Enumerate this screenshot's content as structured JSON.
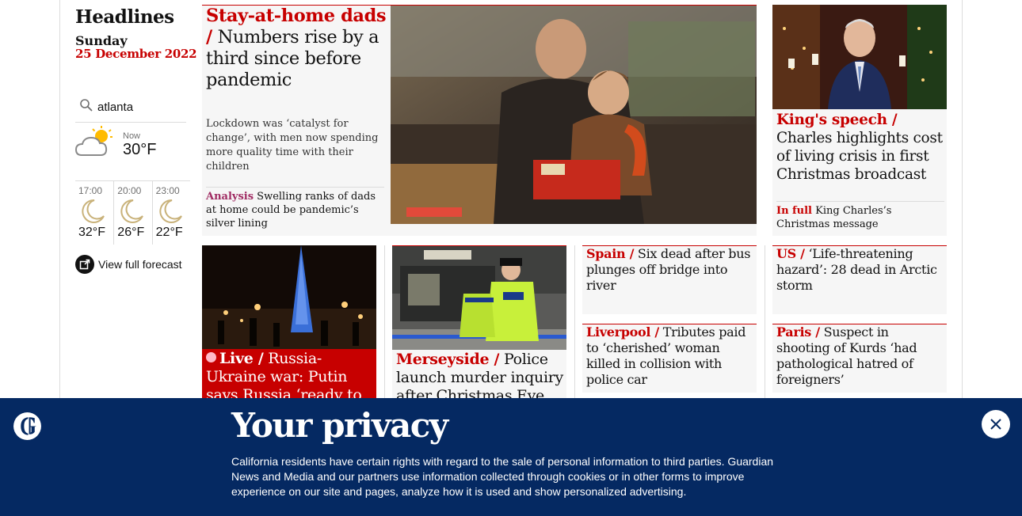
{
  "sidebar": {
    "title": "Headlines",
    "day": "Sunday",
    "date": "25 December 2022",
    "search_value": "atlanta",
    "weather_now_label": "Now",
    "weather_now_temp": "30°F",
    "forecast": [
      {
        "time": "17:00",
        "temp": "32°F",
        "icon": "moon-icon"
      },
      {
        "time": "20:00",
        "temp": "26°F",
        "icon": "moon-icon"
      },
      {
        "time": "23:00",
        "temp": "22°F",
        "icon": "moon-icon"
      }
    ],
    "forecast_link": "View full forecast"
  },
  "lead": {
    "kicker": "Stay-at-home dads",
    "separator": " /",
    "headline": " Numbers rise by a third since before pandemic",
    "standfirst": "Lockdown was ‘catalyst for change’, with men now spending more quality time with their children",
    "sublink_label": "Analysis",
    "sublink_text": " Swelling ranks of dads at home could be pandemic’s silver lining"
  },
  "king": {
    "kicker": "King's speech /",
    "headline": " Charles highlights cost of living crisis in first Christmas broadcast",
    "sublink_label": "In full",
    "sublink_text": " King Charles’s Christmas message"
  },
  "cards": {
    "live": {
      "kicker": "Live /",
      "headline": " Russia-Ukraine war: Putin says Russia ‘ready to"
    },
    "merseyside": {
      "kicker": "Merseyside /",
      "headline": " Police launch murder inquiry after Christmas Eve"
    },
    "spain": {
      "kicker": "Spain /",
      "headline": " Six dead after bus plunges off bridge into river"
    },
    "us": {
      "kicker": "US /",
      "headline": " ‘Life-threatening hazard’: 28 dead in Arctic storm"
    },
    "liverpool": {
      "kicker": "Liverpool /",
      "headline": " Tributes paid to ‘cherished’ woman killed in collision with police car"
    },
    "paris": {
      "kicker": "Paris /",
      "headline": " Suspect in shooting of Kurds ‘had pathological hatred of foreigners’"
    }
  },
  "privacy": {
    "title": "Your privacy",
    "text": "California residents have certain rights with regard to the sale of personal information to third parties. Guardian News and Media and our partners use information collected through cookies or in other forms to improve experience on our site and pages, analyze how it is used and show personalized advertising."
  },
  "colors": {
    "accent_red": "#c70000",
    "analysis_pink": "#a02c63",
    "banner_blue": "#052962"
  }
}
